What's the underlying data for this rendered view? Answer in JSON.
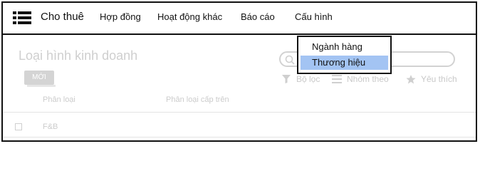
{
  "header": {
    "brand": "Cho thuê",
    "menu_icon": "hamburger-list-icon",
    "nav": [
      "Hợp đồng",
      "Hoạt động khác",
      "Báo cáo",
      "Cấu hình"
    ]
  },
  "dropdown": {
    "items": [
      "Ngành hàng",
      "Thương hiệu"
    ],
    "selected": "Thương hiệu"
  },
  "page": {
    "title": "Loại hình kinh doanh",
    "new_button": "MỚI",
    "search": {
      "icon": "search-icon",
      "value": ""
    },
    "toolbar": {
      "filter": {
        "label": "Bộ lọc",
        "icon": "filter-icon"
      },
      "group": {
        "label": "Nhóm theo",
        "icon": "list-icon"
      },
      "favorite": {
        "label": "Yêu thích",
        "icon": "star-icon"
      }
    },
    "table": {
      "columns": [
        "Phân loại",
        "Phân loại cấp trên"
      ],
      "rows": [
        {
          "name": "F&B",
          "parent": ""
        }
      ]
    }
  },
  "colors": {
    "selected_item": "#a3c4f3",
    "border": "#111111",
    "dimmed_text": "#cccccc"
  }
}
